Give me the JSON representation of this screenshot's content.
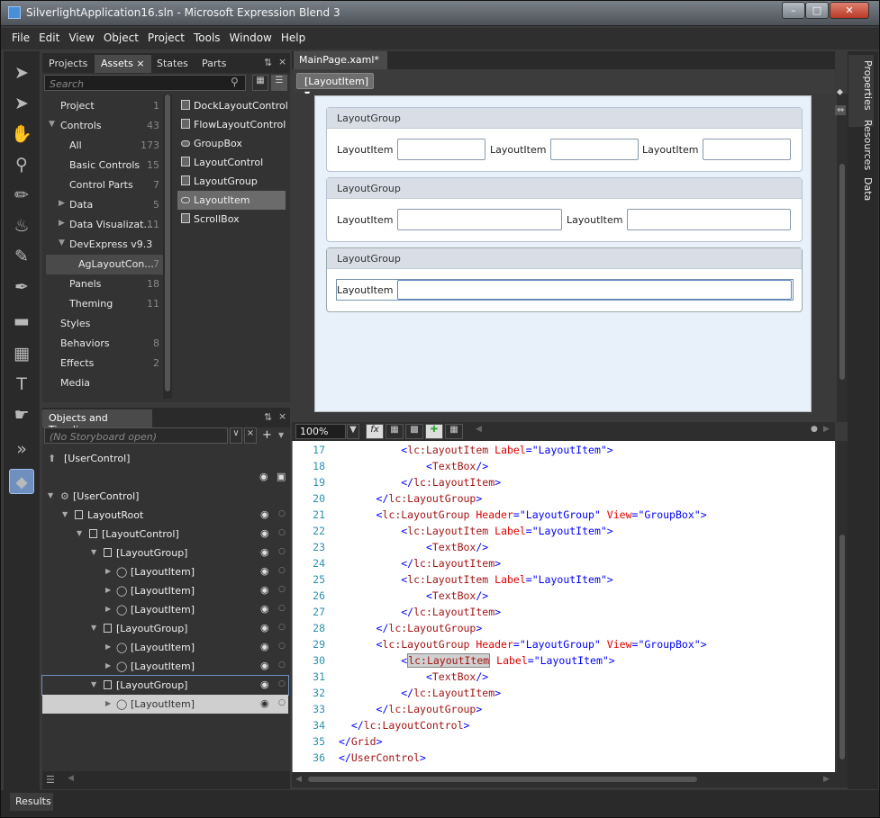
{
  "window": {
    "title": "SilverlightApplication16.sln - Microsoft Expression Blend 3"
  },
  "menu": [
    "File",
    "Edit",
    "View",
    "Object",
    "Project",
    "Tools",
    "Window",
    "Help"
  ],
  "assets_panel": {
    "tabs": [
      "Projects",
      "Assets",
      "States",
      "Parts"
    ],
    "search_placeholder": "Search",
    "categories": [
      {
        "label": "Project",
        "count": "1"
      },
      {
        "label": "Controls",
        "count": "43"
      },
      {
        "label": "All",
        "count": "173"
      },
      {
        "label": "Basic Controls",
        "count": "15"
      },
      {
        "label": "Control Parts",
        "count": "7"
      },
      {
        "label": "Data",
        "count": "5"
      },
      {
        "label": "Data Visualizat...",
        "count": "11"
      },
      {
        "label": "DevExpress v9.3",
        "count": ""
      },
      {
        "label": "AgLayoutCon...",
        "count": "7"
      },
      {
        "label": "Panels",
        "count": "18"
      },
      {
        "label": "Theming",
        "count": "11"
      },
      {
        "label": "Styles",
        "count": ""
      },
      {
        "label": "Behaviors",
        "count": "8"
      },
      {
        "label": "Effects",
        "count": "2"
      },
      {
        "label": "Media",
        "count": ""
      }
    ],
    "items": [
      "DockLayoutControl",
      "FlowLayoutControl",
      "GroupBox",
      "LayoutControl",
      "LayoutGroup",
      "LayoutItem",
      "ScrollBox"
    ]
  },
  "objects_panel": {
    "title": "Objects and Timeline",
    "storyboard": "(No Storyboard open)",
    "usercontrol_top": "[UserControl]",
    "tree": [
      "[UserControl]",
      "LayoutRoot",
      "[LayoutControl]",
      "[LayoutGroup]",
      "[LayoutItem]",
      "[LayoutItem]",
      "[LayoutItem]",
      "[LayoutGroup]",
      "[LayoutItem]",
      "[LayoutItem]",
      "[LayoutGroup]",
      "[LayoutItem]"
    ]
  },
  "document": {
    "tab": "MainPage.xaml*",
    "breadcrumb": "[LayoutItem]",
    "zoom": "100%",
    "groups": [
      {
        "header": "LayoutGroup",
        "items": [
          "LayoutItem",
          "LayoutItem",
          "LayoutItem"
        ]
      },
      {
        "header": "LayoutGroup",
        "items": [
          "LayoutItem",
          "LayoutItem"
        ]
      },
      {
        "header": "LayoutGroup",
        "items": [
          "LayoutItem"
        ]
      }
    ]
  },
  "code": {
    "line_numbers": [
      "17",
      "18",
      "19",
      "20",
      "21",
      "22",
      "23",
      "24",
      "25",
      "26",
      "27",
      "28",
      "29",
      "30",
      "31",
      "32",
      "33",
      "34",
      "35",
      "36"
    ],
    "strings": {
      "lc_layoutitem": "lc:LayoutItem",
      "lc_layoutgroup": "lc:LayoutGroup",
      "lc_layoutcontrol": "lc:LayoutControl",
      "textbox": "TextBox",
      "grid": "Grid",
      "usercontrol": "UserControl",
      "label_attr": "Label",
      "header_attr": "Header",
      "view_attr": "View",
      "layoutitem_val": "\"LayoutItem\"",
      "layoutgroup_val": "\"LayoutGroup\"",
      "groupbox_val": "\"GroupBox\""
    }
  },
  "right_tabs": [
    "Properties",
    "Resources",
    "Data"
  ],
  "status": {
    "results": "Results"
  }
}
